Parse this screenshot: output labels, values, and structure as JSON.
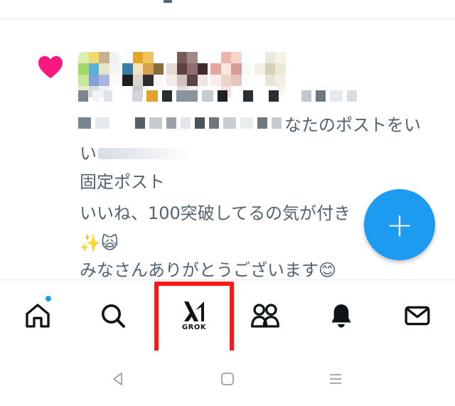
{
  "notification": {
    "partial_text": "なたのポストをい",
    "line_ii": "い",
    "pinned_label": "固定ポスト",
    "post_line1": "いいね、100突破してるの気が付き",
    "post_line2": "✨🙀",
    "post_line3": "みなさんありがとうございます😊",
    "heart_color": "#f91880"
  },
  "fab": {
    "label": "+",
    "color": "#1d9bf0"
  },
  "bottom_nav": {
    "items": [
      {
        "name": "home",
        "icon": "home-icon",
        "has_badge": true
      },
      {
        "name": "search",
        "icon": "search-icon"
      },
      {
        "name": "grok",
        "icon": "grok-icon",
        "label": "GROK"
      },
      {
        "name": "communities",
        "icon": "people-icon"
      },
      {
        "name": "notifications",
        "icon": "bell-icon"
      },
      {
        "name": "messages",
        "icon": "mail-icon"
      }
    ],
    "badge_color": "#1d9bf0",
    "highlight_color": "#ff1a1a"
  },
  "system_nav": [
    "back-icon",
    "home-square-icon",
    "recents-icon"
  ]
}
